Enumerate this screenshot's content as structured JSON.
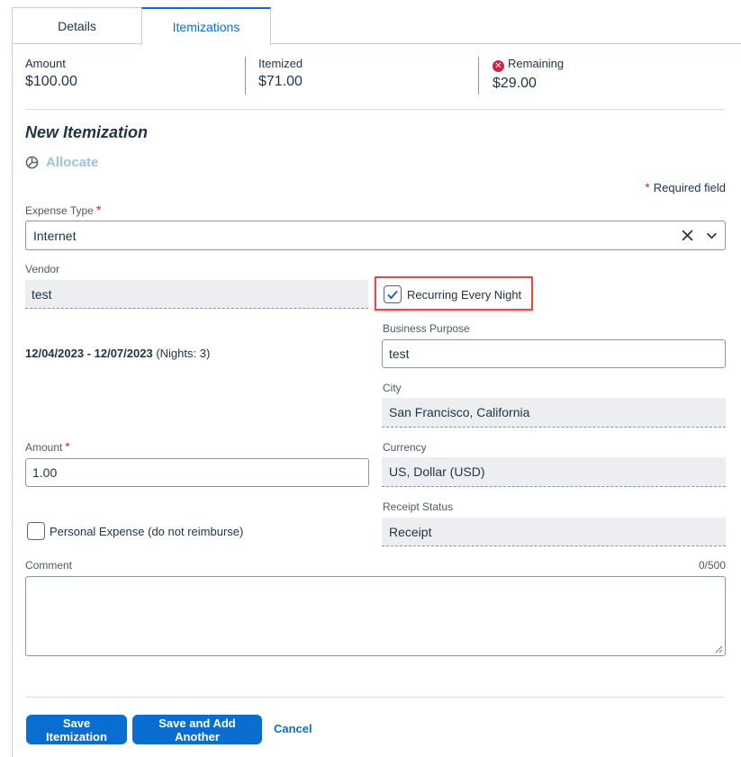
{
  "tabs": {
    "details": "Details",
    "itemizations": "Itemizations"
  },
  "summary": {
    "amount_label": "Amount",
    "amount_value": "$100.00",
    "itemized_label": "Itemized",
    "itemized_value": "$71.00",
    "remaining_label": "Remaining",
    "remaining_value": "$29.00"
  },
  "form": {
    "title": "New Itemization",
    "allocate_label": "Allocate",
    "required_marker": "*",
    "required_note": "Required field",
    "expense_type": {
      "label": "Expense Type",
      "value": "Internet"
    },
    "vendor": {
      "label": "Vendor",
      "value": "test"
    },
    "recurring": {
      "label": "Recurring Every Night",
      "checked": true
    },
    "date_range": {
      "dates": "12/04/2023 - 12/07/2023",
      "nights": "(Nights: 3)"
    },
    "business_purpose": {
      "label": "Business Purpose",
      "value": "test"
    },
    "city": {
      "label": "City",
      "value": "San Francisco, California"
    },
    "amount": {
      "label": "Amount",
      "value": "1.00"
    },
    "currency": {
      "label": "Currency",
      "value": "US, Dollar (USD)"
    },
    "receipt_status": {
      "label": "Receipt Status",
      "value": "Receipt"
    },
    "personal_expense": {
      "label": "Personal Expense (do not reimburse)",
      "checked": false
    },
    "comment": {
      "label": "Comment",
      "counter": "0/500",
      "value": ""
    }
  },
  "actions": {
    "save": "Save Itemization",
    "save_add": "Save and Add Another",
    "cancel": "Cancel"
  },
  "colors": {
    "accent": "#0a6ed1",
    "required": "#d3223f",
    "highlight": "#e5484d"
  }
}
